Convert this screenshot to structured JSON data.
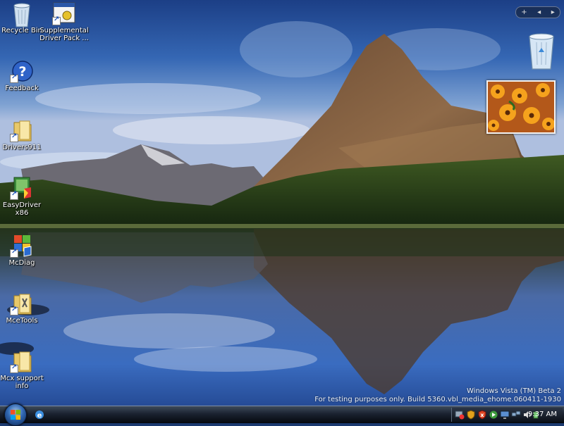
{
  "desktop": {
    "icons": [
      {
        "label": "Recycle Bin",
        "icon": "recycle-bin-icon"
      },
      {
        "label": "Supplemental Driver Pack ...",
        "icon": "driver-pack-shortcut-icon"
      },
      {
        "label": "Feedback",
        "icon": "feedback-help-icon"
      },
      {
        "label": "Drivers911",
        "icon": "folder-shortcut-icon"
      },
      {
        "label": "EasyDriver x86",
        "icon": "easydriver-shortcut-icon"
      },
      {
        "label": "McDiag",
        "icon": "mcdiag-shortcut-icon"
      },
      {
        "label": "MceTools",
        "icon": "mcetools-shortcut-icon"
      },
      {
        "label": "Mcx support info",
        "icon": "folder-shortcut-icon"
      }
    ]
  },
  "sidebar": {
    "controls": {
      "add": "+",
      "prev": "◂",
      "next": "▸"
    },
    "gadgets": [
      "recycle-bin-gadget",
      "slideshow-gadget"
    ]
  },
  "watermark": {
    "line1": "Windows Vista (TM) Beta 2",
    "line2": "For testing purposes only. Build 5360.vbl_media_ehome.060411-1930"
  },
  "taskbar": {
    "start_icon": "windows-logo-icon",
    "quick_launch": [
      "internet-explorer-icon"
    ],
    "tray_icons": [
      "network-alert-icon",
      "windows-defender-icon",
      "security-center-alert-icon",
      "media-icon",
      "display-icon",
      "network-icon",
      "volume-icon",
      "power-icon"
    ],
    "clock": "9:37 AM"
  },
  "colors": {
    "sky": "#2a5aa8",
    "taskbar": "#0b1018",
    "label_text": "#ffffff"
  }
}
